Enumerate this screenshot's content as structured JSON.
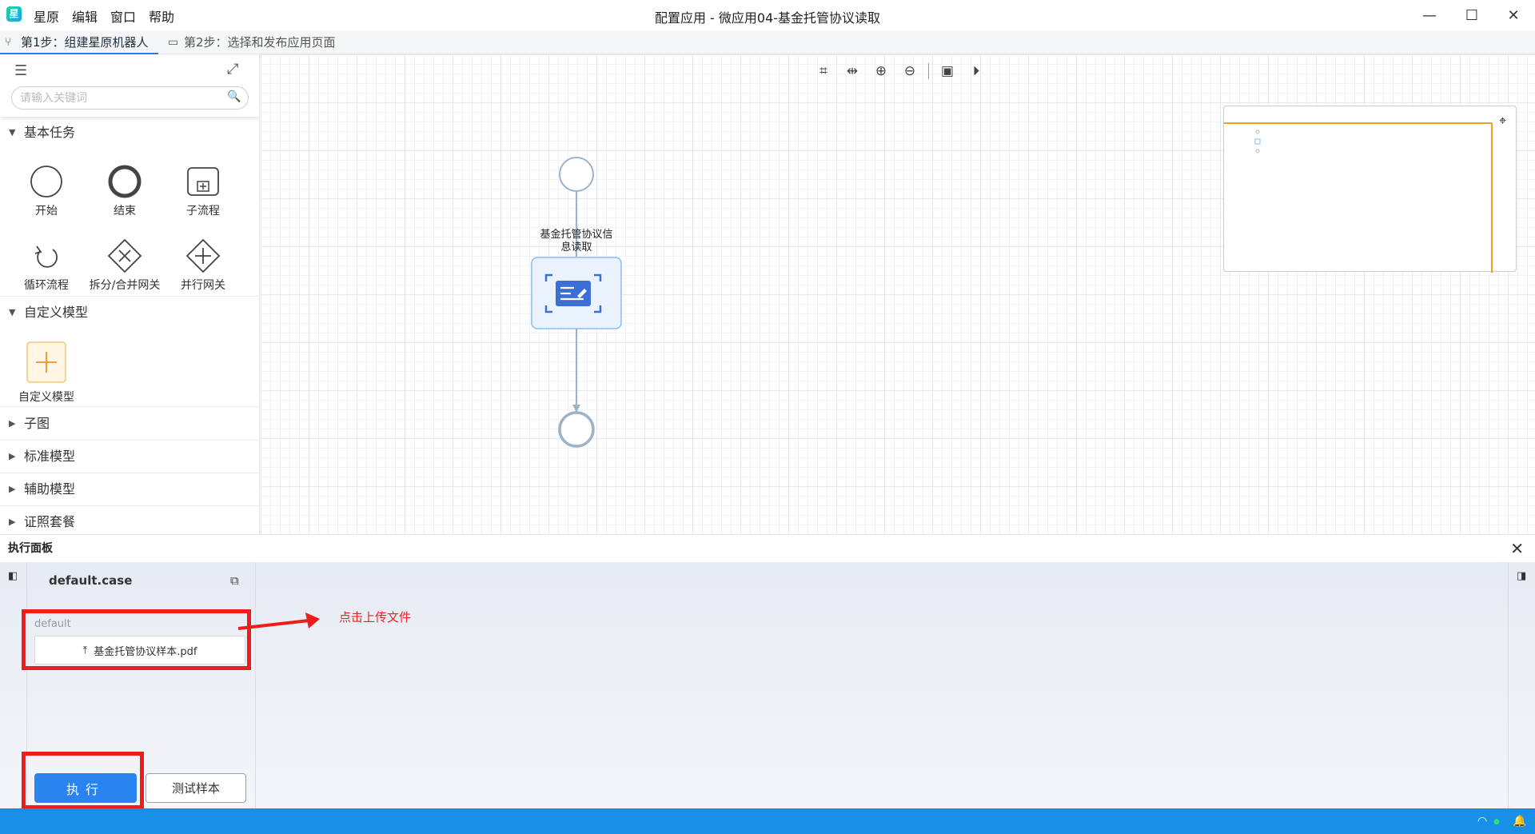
{
  "titlebar": {
    "logo": "星",
    "menu": [
      "星原",
      "编辑",
      "窗口",
      "帮助"
    ],
    "title": "配置应用 - 微应用04-基金托管协议读取"
  },
  "tabs": [
    {
      "label": "第1步：组建星原机器人",
      "icon": "flow-icon",
      "active": true
    },
    {
      "label": "第2步：选择和发布应用页面",
      "icon": "page-icon",
      "active": false
    }
  ],
  "sidebar": {
    "search_placeholder": "请输入关键词",
    "sections": {
      "basic": "基本任务",
      "custom": "自定义模型",
      "subgraph": "子图",
      "standard": "标准模型",
      "assist": "辅助模型",
      "license": "证照套餐"
    },
    "basic_tools": [
      "开始",
      "结束",
      "子流程",
      "循环流程",
      "拆分/合并网关",
      "并行网关"
    ],
    "custom_tool": "自定义模型"
  },
  "canvas": {
    "task_label_line1": "基金托管协议信",
    "task_label_line2": "息读取"
  },
  "exec_panel": {
    "title": "执行面板",
    "case_name": "default.case",
    "field_label": "default",
    "file_name": "基金托管协议样本.pdf",
    "execute_label": "执行",
    "sample_label": "测试样本"
  },
  "annotation": {
    "text": "点击上传文件",
    "color": "#ee2222"
  },
  "colors": {
    "accent": "#2a84f0",
    "statusbar": "#1a8fe8",
    "highlight": "#ef1c1c",
    "minimap_view": "#f0a020"
  }
}
